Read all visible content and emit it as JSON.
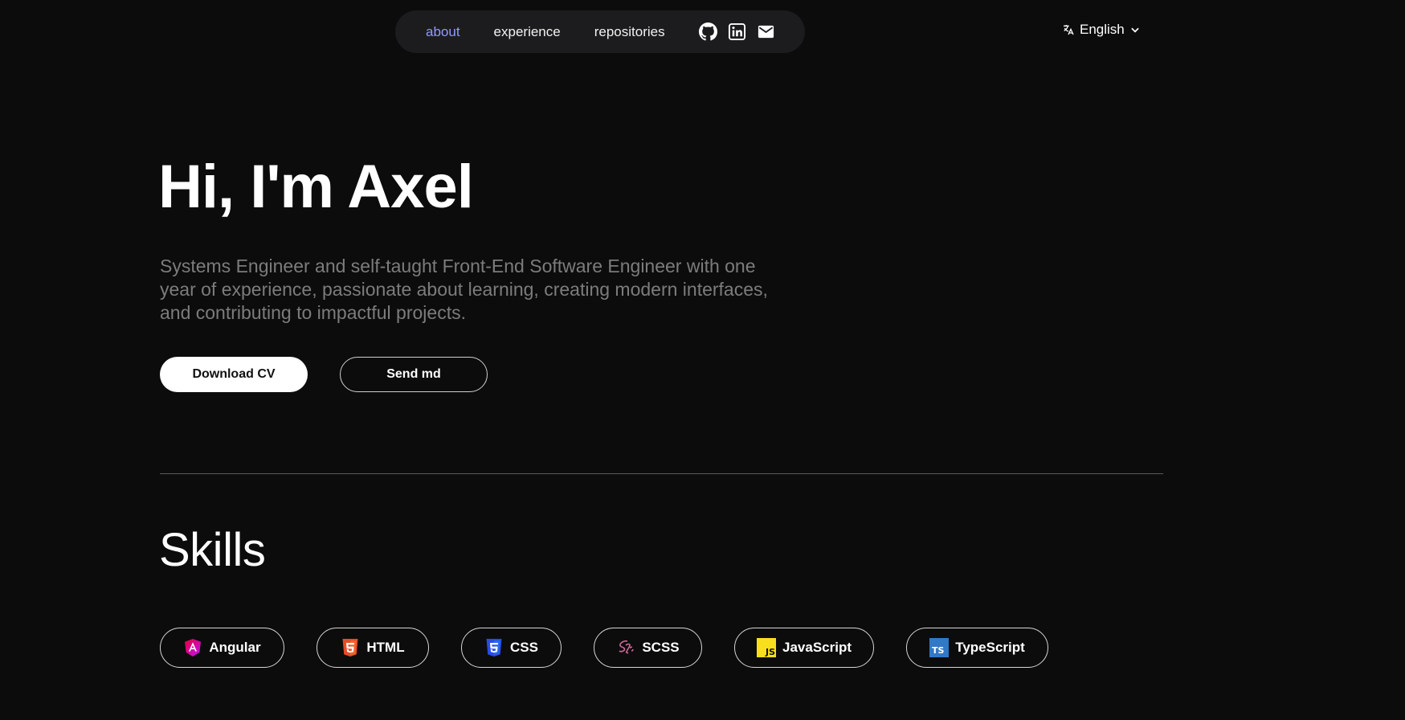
{
  "nav": {
    "links": [
      {
        "label": "about",
        "active": true
      },
      {
        "label": "experience",
        "active": false
      },
      {
        "label": "repositories",
        "active": false
      }
    ],
    "social_icons": [
      "github-icon",
      "linkedin-icon",
      "mail-icon"
    ]
  },
  "language": {
    "label": "English",
    "icon": "translate-icon"
  },
  "hero": {
    "title": "Hi, I'm Axel",
    "description": "Systems Engineer and self-taught Front-End Software Engineer with one year of experience, passionate about learning, creating modern interfaces, and contributing to impactful projects.",
    "primary_button": "Download CV",
    "secondary_button": "Send md"
  },
  "skills": {
    "title": "Skills",
    "items": [
      {
        "label": "Angular",
        "icon": "angular-icon"
      },
      {
        "label": "HTML",
        "icon": "html5-icon"
      },
      {
        "label": "CSS",
        "icon": "css3-icon"
      },
      {
        "label": "SCSS",
        "icon": "sass-icon"
      },
      {
        "label": "JavaScript",
        "icon": "javascript-icon"
      },
      {
        "label": "TypeScript",
        "icon": "typescript-icon"
      }
    ]
  },
  "colors": {
    "background": "#0c0c0c",
    "nav_background": "#1c1c1e",
    "active_link": "#8f9bff",
    "muted_text": "#7c7c7c"
  }
}
